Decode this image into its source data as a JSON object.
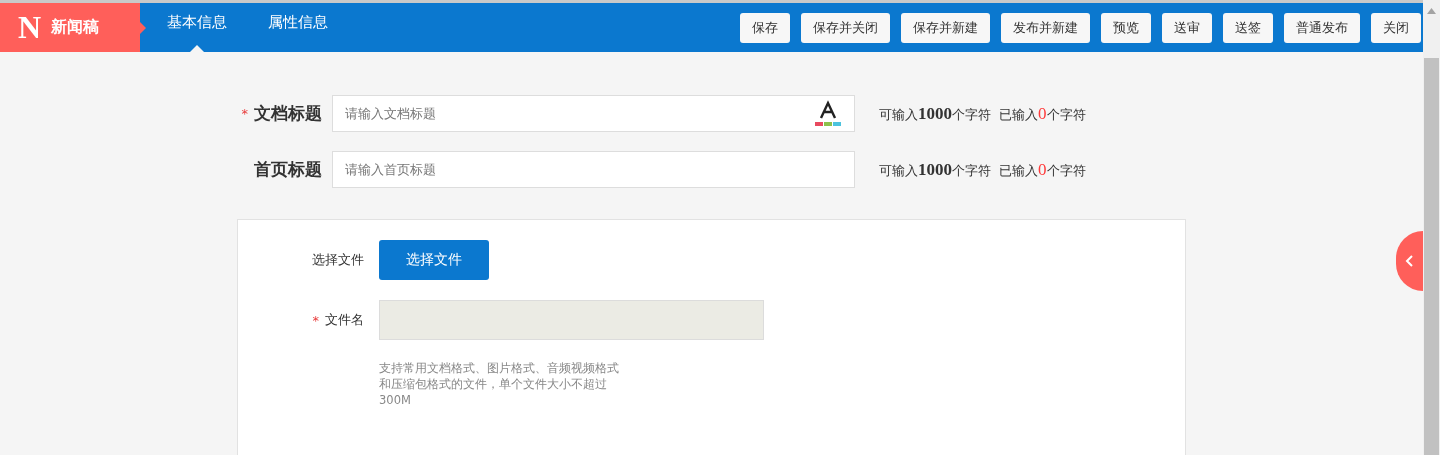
{
  "logo": {
    "letter": "N",
    "title": "新闻稿"
  },
  "tabs": [
    {
      "label": "基本信息",
      "selected": true
    },
    {
      "label": "属性信息",
      "selected": false
    }
  ],
  "actions": [
    "保存",
    "保存并关闭",
    "保存并新建",
    "发布并新建",
    "预览",
    "送审",
    "送签",
    "普通发布",
    "关闭"
  ],
  "title_fields": [
    {
      "label": "文档标题",
      "required_mark": "*",
      "placeholder": "请输入文档标题",
      "font_tool": true,
      "counter": {
        "max_prefix": "可输入",
        "max": "1000",
        "max_suffix": "个字符",
        "count_prefix": "已输入",
        "count": "0",
        "count_suffix": "个字符"
      }
    },
    {
      "label": "首页标题",
      "placeholder": "请输入首页标题",
      "font_tool": false,
      "counter": {
        "max_prefix": "可输入",
        "max": "1000",
        "max_suffix": "个字符",
        "count_prefix": "已输入",
        "count": "0",
        "count_suffix": "个字符"
      }
    }
  ],
  "file_card": {
    "choose_label": "选择文件",
    "choose_button": "选择文件",
    "filename_label": "文件名",
    "filename_required_mark": "*",
    "help": [
      "支持常用文档格式、图片格式、音频视频格式",
      "和压缩包格式的文件，单个文件大小不超过",
      "300M"
    ]
  }
}
